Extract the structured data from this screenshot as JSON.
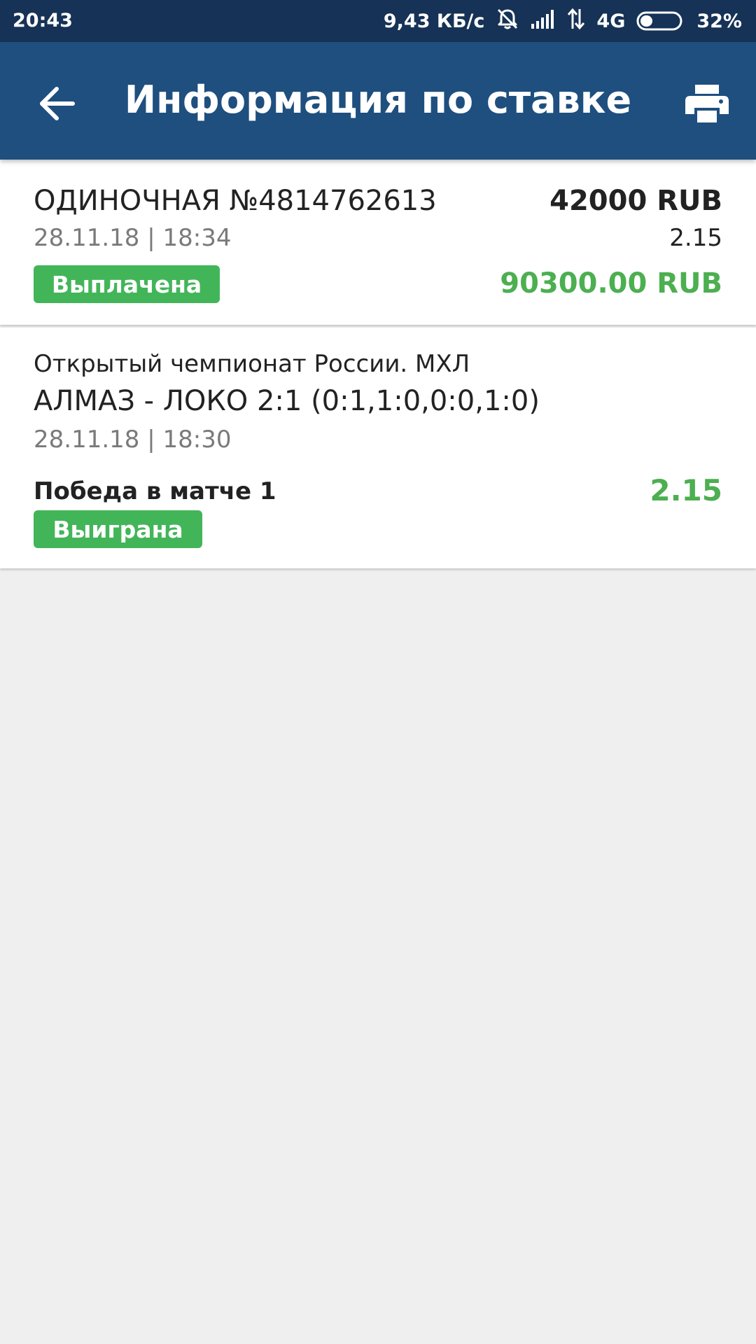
{
  "status_bar": {
    "time": "20:43",
    "network_speed": "9,43 КБ/с",
    "network_type": "4G",
    "battery_percent": "32%",
    "battery_level": 0.32,
    "icons": [
      "alarm-off-icon",
      "signal-icon",
      "data-transfer-icon",
      "battery-icon"
    ]
  },
  "header": {
    "title": "Информация по ставке",
    "back_icon": "arrow-back-icon",
    "print_icon": "print-icon"
  },
  "bet": {
    "title": "ОДИНОЧНАЯ №4814762613",
    "date": "28.11.18 | 18:34",
    "stake": "42000 RUB",
    "coefficient": "2.15",
    "status": "Выплачена",
    "payout": "90300.00 RUB"
  },
  "event": {
    "league": "Открытый чемпионат России. МХЛ",
    "match": "АЛМАЗ - ЛОКО 2:1 (0:1,1:0,0:0,1:0)",
    "date": "28.11.18 | 18:30",
    "outcome": "Победа в матче 1",
    "coefficient": "2.15",
    "status": "Выиграна"
  },
  "colors": {
    "status_bar": "#163256",
    "app_bar": "#1e4f7f",
    "success_green": "#4caf50",
    "badge_green": "#43b559",
    "background": "#efefef",
    "card": "#ffffff"
  }
}
